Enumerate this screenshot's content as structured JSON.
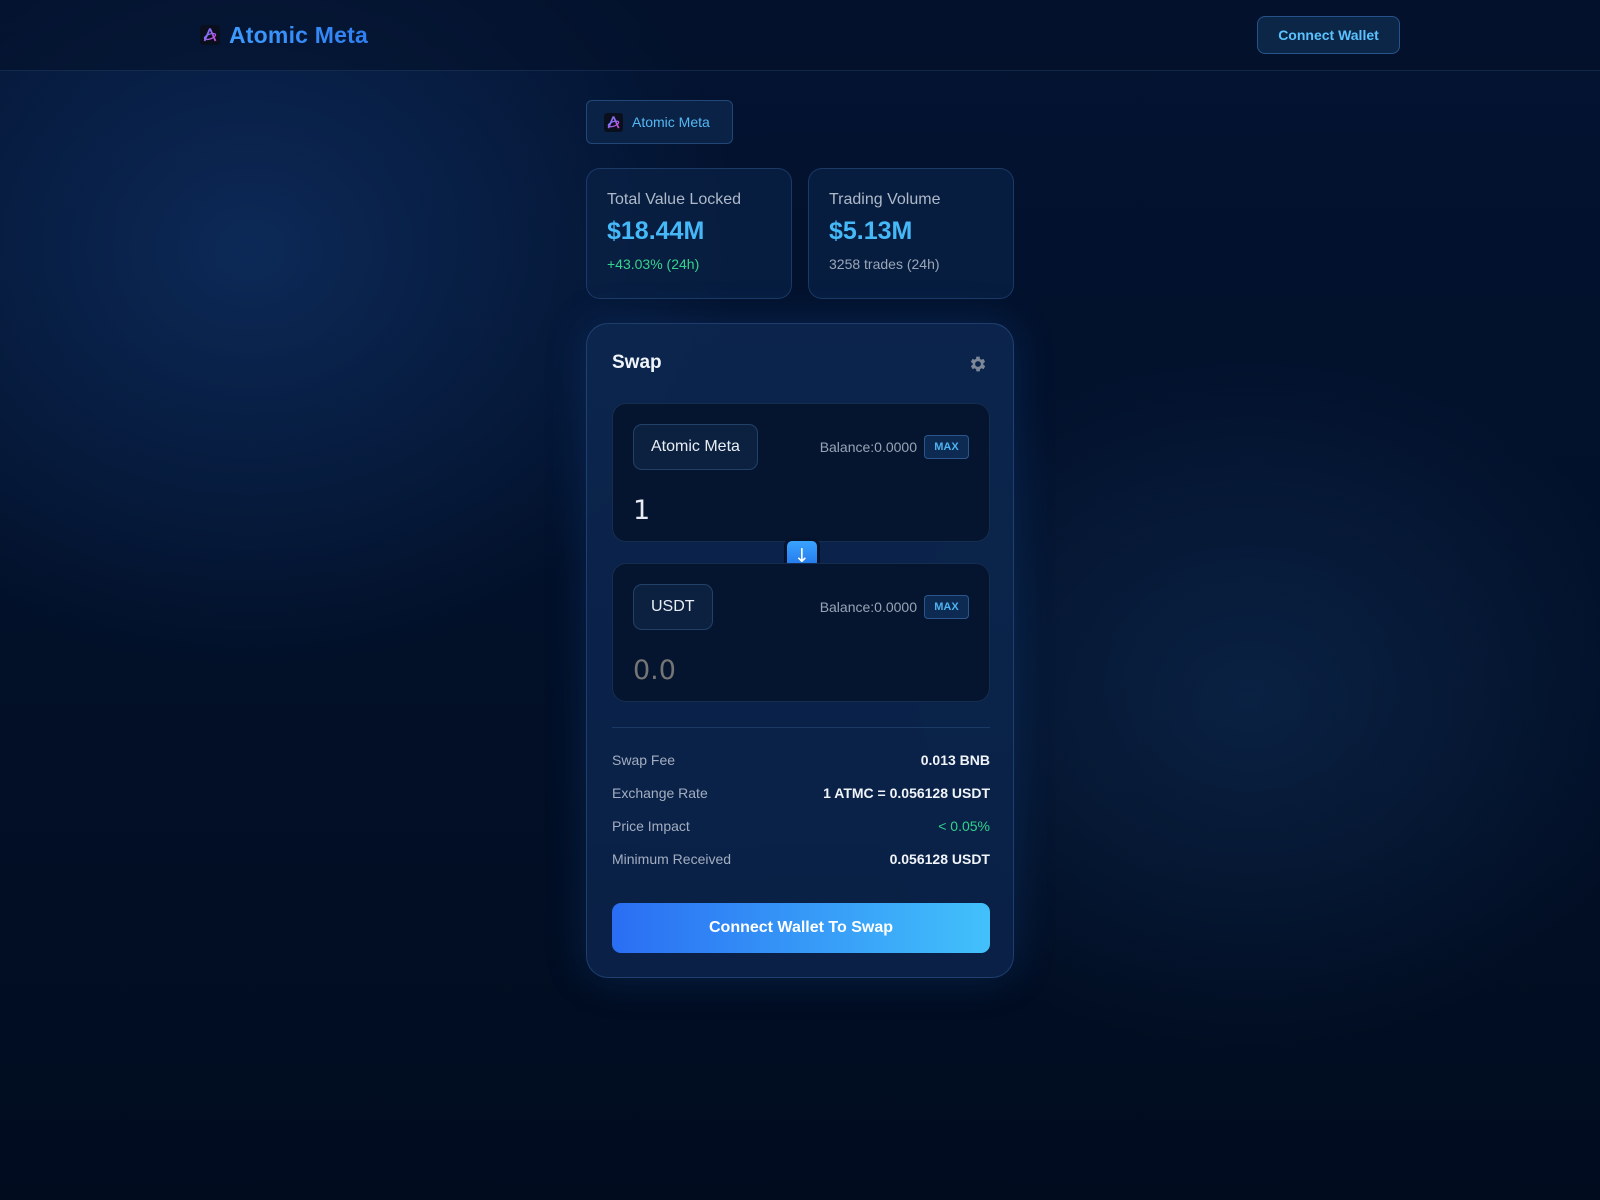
{
  "header": {
    "brand_name": "Atomic Meta",
    "connect_label": "Connect Wallet"
  },
  "badge": {
    "label": "Atomic Meta"
  },
  "stats": {
    "tvl": {
      "title": "Total Value Locked",
      "value": "$18.44M",
      "sub": "+43.03% (24h)"
    },
    "volume": {
      "title": "Trading Volume",
      "value": "$5.13M",
      "sub": "3258 trades (24h)"
    }
  },
  "swap": {
    "title": "Swap",
    "from": {
      "token": "Atomic Meta",
      "balance": "Balance:0.0000",
      "max": "MAX",
      "amount": "1"
    },
    "to": {
      "token": "USDT",
      "balance": "Balance:0.0000",
      "max": "MAX",
      "placeholder": "0.0"
    },
    "switch_arrow": "↓",
    "details": [
      {
        "label": "Swap Fee",
        "value": "0.013 BNB"
      },
      {
        "label": "Exchange Rate",
        "value": "1 ATMC = 0.056128 USDT"
      },
      {
        "label": "Price Impact",
        "value": "< 0.05%"
      },
      {
        "label": "Minimum Received",
        "value": "0.056128 USDT"
      }
    ],
    "cta_label": "Connect Wallet To Swap"
  },
  "icons": {
    "logo": "atom-logo-icon",
    "settings": "gear-icon",
    "switch": "arrow-down-icon"
  },
  "colors": {
    "accent": "#45b8f7",
    "positive": "#35d48e",
    "cta_start": "#2a6ef3",
    "cta_end": "#42c1fb"
  }
}
